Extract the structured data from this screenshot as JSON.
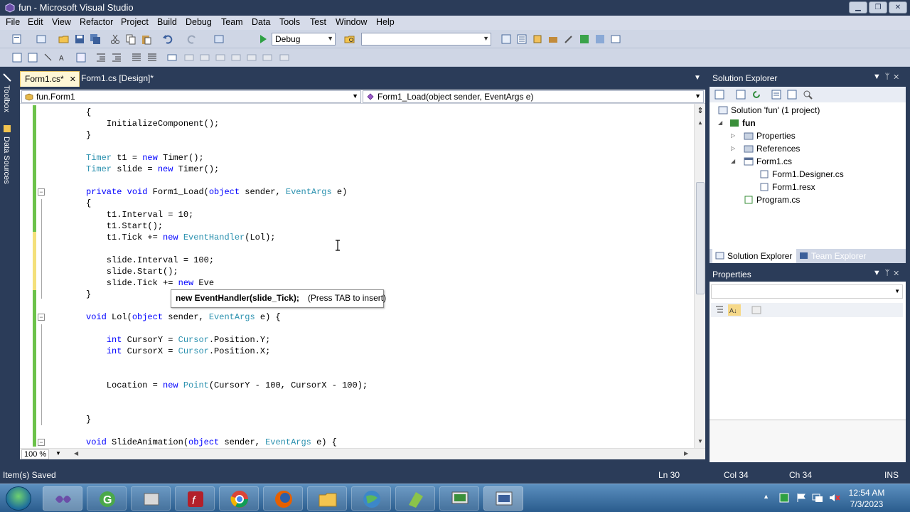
{
  "window": {
    "title": "fun - Microsoft Visual Studio"
  },
  "menu": [
    "File",
    "Edit",
    "View",
    "Refactor",
    "Project",
    "Build",
    "Debug",
    "Team",
    "Data",
    "Tools",
    "Test",
    "Window",
    "Help"
  ],
  "toolbar": {
    "config": "Debug",
    "platform": ""
  },
  "tabs": [
    {
      "label": "Form1.cs*",
      "close": "✕"
    },
    {
      "label": "Form1.cs [Design]*"
    }
  ],
  "nav": {
    "type": "fun.Form1",
    "member": "Form1_Load(object sender, EventArgs e)"
  },
  "left_tabs": {
    "toolbox": "Toolbox",
    "data_sources": "Data Sources"
  },
  "code": {
    "l1": "{",
    "l2": "    InitializeComponent();",
    "l3": "}",
    "l4a": "Timer",
    "l4b": " t1 = ",
    "l4c": "new",
    "l4d": " Timer",
    "l4e": "();",
    "l5a": "Timer",
    "l5b": " slide = ",
    "l5c": "new",
    "l5d": " Timer",
    "l5e": "();",
    "l6a": "private",
    "l6b": " ",
    "l6c": "void",
    "l6d": " Form1_Load(",
    "l6e": "object",
    "l6f": " sender, ",
    "l6g": "EventArgs",
    "l6h": " e)",
    "l7": "{",
    "l8": "    t1.Interval = 10;",
    "l9": "    t1.Start();",
    "l10a": "    t1.Tick += ",
    "l10b": "new",
    "l10c": " ",
    "l10d": "EventHandler",
    "l10e": "(Lol);",
    "l11": "    slide.Interval = 100;",
    "l12": "    slide.Start();",
    "l13a": "    slide.Tick += ",
    "l13b": "new",
    "l13c": " Eve",
    "l14": "}",
    "l15a": "void",
    "l15b": " Lol(",
    "l15c": "object",
    "l15d": " sender, ",
    "l15e": "EventArgs",
    "l15f": " e) {",
    "l16a": "    ",
    "l16b": "int",
    "l16c": " CursorY = ",
    "l16d": "Cursor",
    "l16e": ".Position.Y;",
    "l17a": "    ",
    "l17b": "int",
    "l17c": " CursorX = ",
    "l17d": "Cursor",
    "l17e": ".Position.X;",
    "l18a": "    Location = ",
    "l18b": "new",
    "l18c": " ",
    "l18d": "Point",
    "l18e": "(CursorY - 100, CursorX - 100);",
    "l19": "}",
    "l20a": "void",
    "l20b": " SlideAnimation(",
    "l20c": "object",
    "l20d": " sender, ",
    "l20e": "EventArgs",
    "l20f": " e) {"
  },
  "intellisense": {
    "suggestion": "new EventHandler(slide_Tick);",
    "hint": "(Press TAB to insert)"
  },
  "editor": {
    "zoom": "100 %"
  },
  "solution_explorer": {
    "title": "Solution Explorer",
    "items": [
      "Solution 'fun' (1 project)",
      "fun",
      "Properties",
      "References",
      "Form1.cs",
      "Form1.Designer.cs",
      "Form1.resx",
      "Program.cs"
    ],
    "tabs": [
      "Solution Explorer",
      "Team Explorer"
    ]
  },
  "properties": {
    "title": "Properties"
  },
  "status": {
    "message": "Item(s) Saved",
    "ln": "Ln 30",
    "col": "Col 34",
    "ch": "Ch 34",
    "mode": "INS"
  },
  "taskbar": {
    "time": "12:54 AM",
    "date": "7/3/2023"
  },
  "colors": {
    "keyword": "#0000ff",
    "type": "#2b91af",
    "chrome": "#2b3c59"
  }
}
